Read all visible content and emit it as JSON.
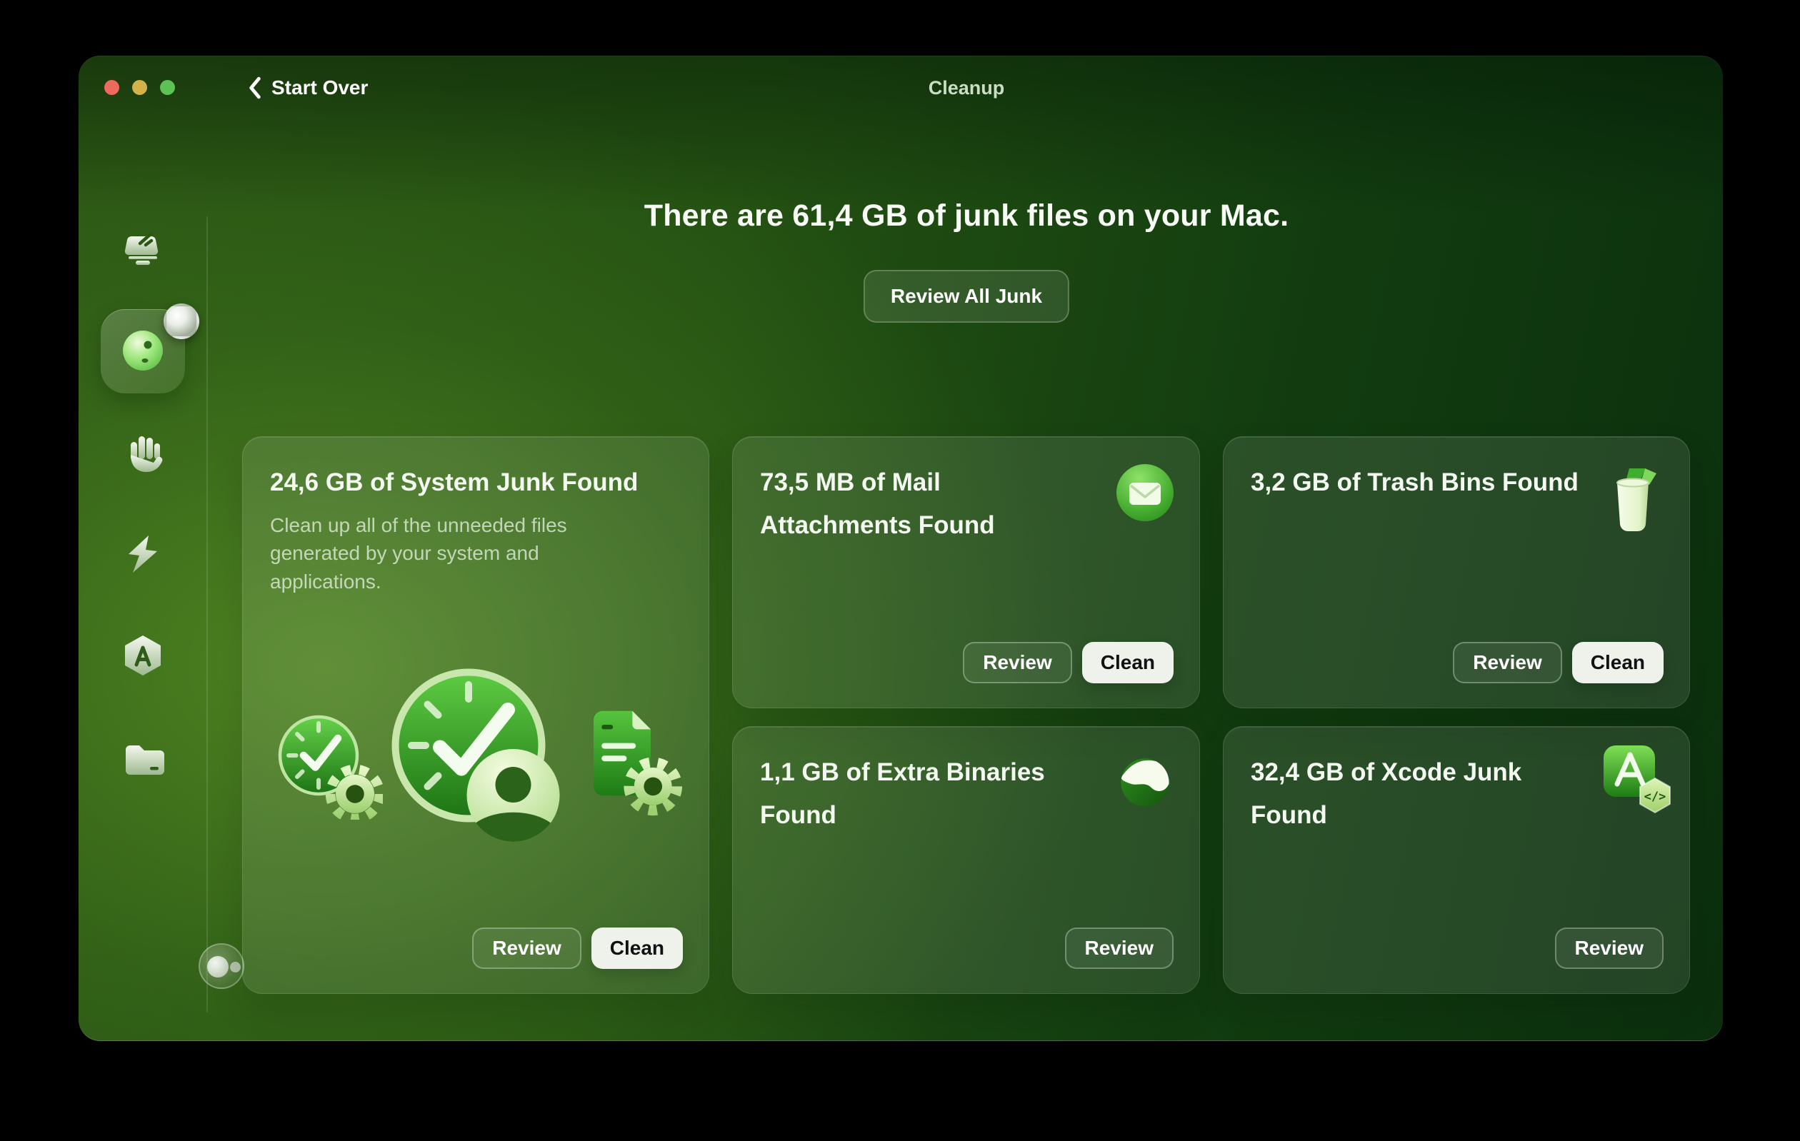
{
  "titlebar": {
    "back_label": "Start Over",
    "title": "Cleanup"
  },
  "header": {
    "headline": "There are 61,4 GB of junk files on your Mac.",
    "review_all_label": "Review All Junk"
  },
  "sidebar": {
    "items": [
      {
        "name": "smart-scan",
        "icon": "scanner-icon",
        "active": false
      },
      {
        "name": "cleanup",
        "icon": "cleanup-disc-icon",
        "active": true,
        "has_badge": true
      },
      {
        "name": "protection",
        "icon": "hand-icon",
        "active": false
      },
      {
        "name": "performance",
        "icon": "lightning-icon",
        "active": false
      },
      {
        "name": "applications",
        "icon": "hexagon-a-icon",
        "active": false
      },
      {
        "name": "my-clutter",
        "icon": "folder-icon",
        "active": false
      }
    ],
    "footer": {
      "name": "assistant",
      "icon": "bubbles-icon"
    }
  },
  "cards": [
    {
      "key": "system-junk",
      "title": "24,6 GB of System Junk Found",
      "description": "Clean up all of the unneeded files generated by your system and applications.",
      "review_label": "Review",
      "clean_label": "Clean",
      "icons": [
        "clock-gear-icon",
        "clock-user-icon",
        "document-gear-icon"
      ]
    },
    {
      "key": "mail-attachments",
      "title": "73,5 MB of Mail Attachments Found",
      "review_label": "Review",
      "clean_label": "Clean",
      "icon": "mail-icon"
    },
    {
      "key": "trash-bins",
      "title": "3,2 GB of Trash Bins Found",
      "review_label": "Review",
      "clean_label": "Clean",
      "icon": "trash-icon"
    },
    {
      "key": "extra-binaries",
      "title": "1,1 GB of Extra Binaries Found",
      "review_label": "Review",
      "icon": "binaries-icon"
    },
    {
      "key": "xcode-junk",
      "title": "32,4 GB of Xcode Junk Found",
      "review_label": "Review",
      "icon": "xcode-icon"
    }
  ],
  "colors": {
    "window_bright_green": "#45741f",
    "window_dark_green": "#0b2f0d",
    "card_overlay": "rgba(255,255,255,0.10)",
    "clean_button_bg": "#eef2ea",
    "clean_button_text": "#121212",
    "traffic_red": "#ee6a5d",
    "traffic_yellow": "#d3b24a",
    "traffic_green": "#5dc254"
  }
}
